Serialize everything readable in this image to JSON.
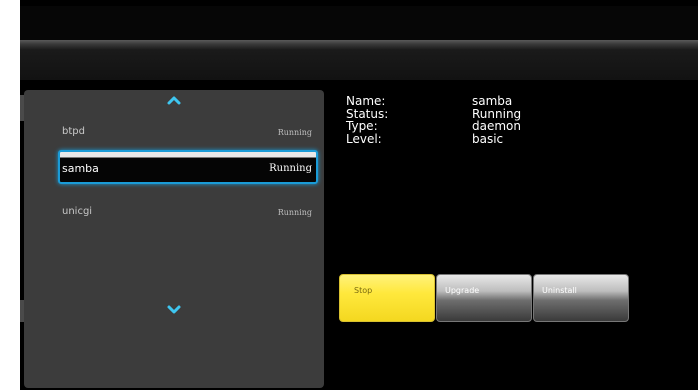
{
  "services": [
    {
      "name": "btpd",
      "status": "Running"
    },
    {
      "name": "samba",
      "status": "Running"
    },
    {
      "name": "unicgi",
      "status": "Running"
    }
  ],
  "details": {
    "name_label": "Name:",
    "name_value": "samba",
    "status_label": "Status:",
    "status_value": "Running",
    "type_label": "Type:",
    "type_value": "daemon",
    "level_label": "Level:",
    "level_value": "basic"
  },
  "actions": {
    "stop_label": "Stop",
    "upgrade_label": "Upgrade",
    "uninstall_label": "Uninstall"
  },
  "icons": {
    "scroll_up": "chevron-up-icon",
    "scroll_down": "chevron-down-icon"
  },
  "colors": {
    "selection_border": "#1a9bd7",
    "stop_button": "#ffe83c",
    "panel_background": "#3c3c3c"
  }
}
